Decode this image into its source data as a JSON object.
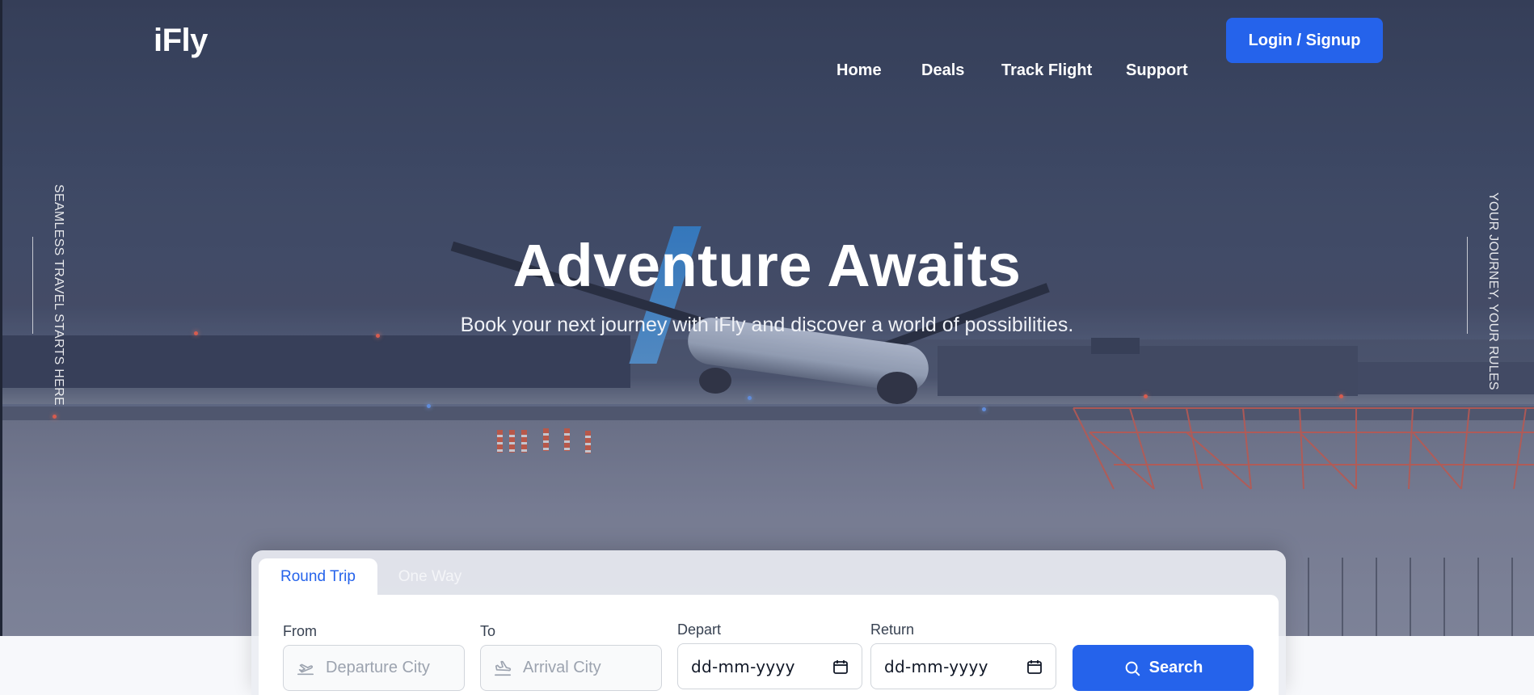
{
  "brand": {
    "logo": "iFly"
  },
  "nav": {
    "items": [
      {
        "label": "Home"
      },
      {
        "label": "Deals"
      },
      {
        "label": "Track Flight"
      },
      {
        "label": "Support"
      }
    ],
    "login_label": "Login / Signup"
  },
  "side": {
    "left_text": "SEAMLESS TRAVEL STARTS HERE",
    "right_text": "YOUR JOURNEY, YOUR RULES"
  },
  "hero": {
    "title": "Adventure Awaits",
    "subtitle": "Book your next journey with iFly and discover a world of possibilities."
  },
  "booking": {
    "tabs": [
      {
        "label": "Round Trip",
        "active": true
      },
      {
        "label": "One Way",
        "active": false
      }
    ],
    "from": {
      "label": "From",
      "placeholder": "Departure City",
      "icon": "plane-takeoff-icon"
    },
    "to": {
      "label": "To",
      "placeholder": "Arrival City",
      "icon": "plane-landing-icon"
    },
    "depart": {
      "label": "Depart",
      "value": "dd-mm-yyyy",
      "icon": "calendar-icon"
    },
    "return": {
      "label": "Return",
      "value": "dd-mm-yyyy",
      "icon": "calendar-icon"
    },
    "search_label": "Search",
    "search_icon": "search-icon"
  },
  "colors": {
    "accent": "#2563eb",
    "text_dark": "#111827",
    "placeholder": "#9ca3af"
  }
}
